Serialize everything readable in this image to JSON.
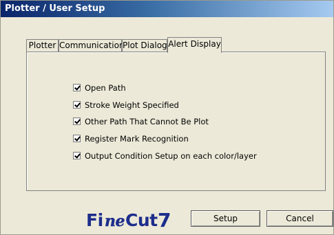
{
  "window": {
    "title": "Plotter / User Setup"
  },
  "tabs": [
    {
      "label": "Plotter",
      "active": false
    },
    {
      "label": "Communication",
      "active": false
    },
    {
      "label": "Plot Dialog",
      "active": false
    },
    {
      "label": "Alert Display",
      "active": true
    }
  ],
  "alert_options": [
    {
      "label": "Open Path",
      "checked": true
    },
    {
      "label": "Stroke Weight Specified",
      "checked": true
    },
    {
      "label": "Other Path That Cannot Be Plot",
      "checked": true
    },
    {
      "label": "Register Mark Recognition",
      "checked": true
    },
    {
      "label": "Output Condition Setup on each color/layer",
      "checked": true
    }
  ],
  "footer": {
    "logo_text": "FineCut7",
    "setup_label": "Setup",
    "cancel_label": "Cancel"
  },
  "colors": {
    "titlebar_start": "#0a246a",
    "titlebar_end": "#a6caf0",
    "dialog_bg": "#ece9d8",
    "logo_color": "#1d2d8c"
  }
}
